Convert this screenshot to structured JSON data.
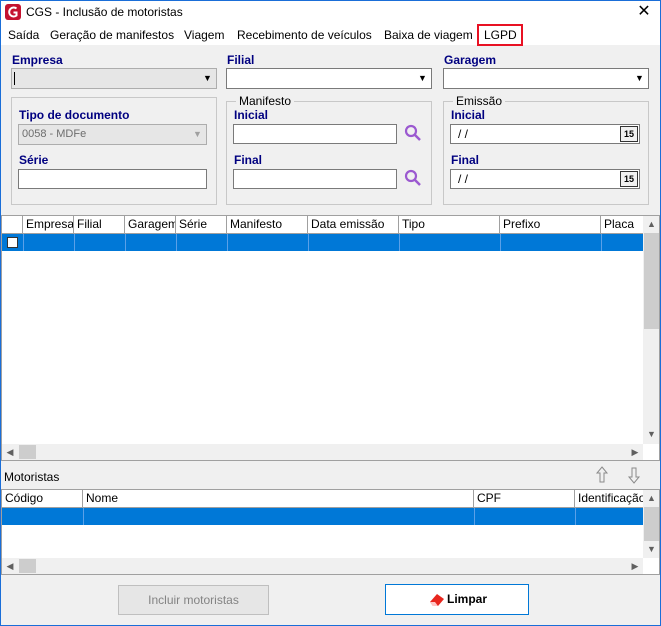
{
  "window": {
    "title": "CGS - Inclusão de motoristas",
    "close": "✕"
  },
  "menu": [
    "Saída",
    "Geração de manifestos",
    "Viagem",
    "Recebimento de veículos",
    "Baixa de viagem",
    "LGPD"
  ],
  "filters": {
    "empresa_label": "Empresa",
    "filial_label": "Filial",
    "garagem_label": "Garagem",
    "tipo_documento_label": "Tipo de documento",
    "tipo_documento_value": "0058 - MDFe",
    "serie_label": "Série",
    "manifesto_group": "Manifesto",
    "manifesto_inicial_label": "Inicial",
    "manifesto_final_label": "Final",
    "emissao_group": "Emissão",
    "emissao_inicial_label": "Inicial",
    "emissao_inicial_value": " /  /",
    "emissao_final_label": "Final",
    "emissao_final_value": " /  /",
    "calendar_text": "15"
  },
  "manifest_grid": {
    "columns": [
      "Empresa",
      "Filial",
      "Garagem",
      "Série",
      "Manifesto",
      "Data emissão",
      "Tipo",
      "Prefixo",
      "Placa"
    ]
  },
  "drivers": {
    "section_label": "Motoristas",
    "columns": [
      "Código",
      "Nome",
      "CPF",
      "Identificação"
    ]
  },
  "buttons": {
    "incluir": "Incluir motoristas",
    "limpar": "Limpar"
  },
  "colors": {
    "accent": "#0078d7",
    "label_blue": "#000080",
    "highlight": "#e81123"
  }
}
